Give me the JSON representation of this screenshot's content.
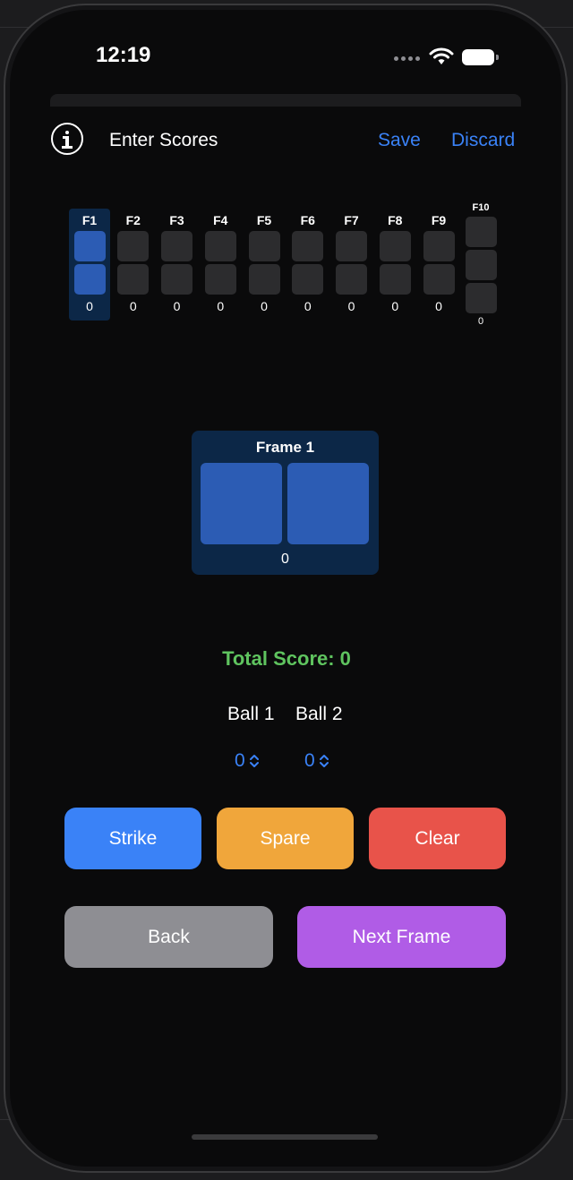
{
  "status_bar": {
    "time": "12:19"
  },
  "nav": {
    "title": "Enter Scores",
    "save_label": "Save",
    "discard_label": "Discard",
    "accent_color": "#3a82f7"
  },
  "scorecard": {
    "frames": [
      {
        "label": "F1",
        "total": "0",
        "selected": true
      },
      {
        "label": "F2",
        "total": "0",
        "selected": false
      },
      {
        "label": "F3",
        "total": "0",
        "selected": false
      },
      {
        "label": "F4",
        "total": "0",
        "selected": false
      },
      {
        "label": "F5",
        "total": "0",
        "selected": false
      },
      {
        "label": "F6",
        "total": "0",
        "selected": false
      },
      {
        "label": "F7",
        "total": "0",
        "selected": false
      },
      {
        "label": "F8",
        "total": "0",
        "selected": false
      },
      {
        "label": "F9",
        "total": "0",
        "selected": false
      }
    ],
    "tenth": {
      "label": "F10",
      "total": "0"
    }
  },
  "current_frame": {
    "title": "Frame 1",
    "total": "0"
  },
  "total_score": {
    "label": "Total Score: 0",
    "color": "#5fc45f"
  },
  "ball_inputs": {
    "ball1_label": "Ball 1",
    "ball2_label": "Ball 2",
    "ball1_value": "0",
    "ball2_value": "0"
  },
  "actions": {
    "strike": {
      "label": "Strike",
      "color": "#3a82f7"
    },
    "spare": {
      "label": "Spare",
      "color": "#f0a63b"
    },
    "clear": {
      "label": "Clear",
      "color": "#e8534a"
    },
    "back": {
      "label": "Back",
      "color": "#8e8e93"
    },
    "next": {
      "label": "Next Frame",
      "color": "#b05ce6"
    }
  }
}
